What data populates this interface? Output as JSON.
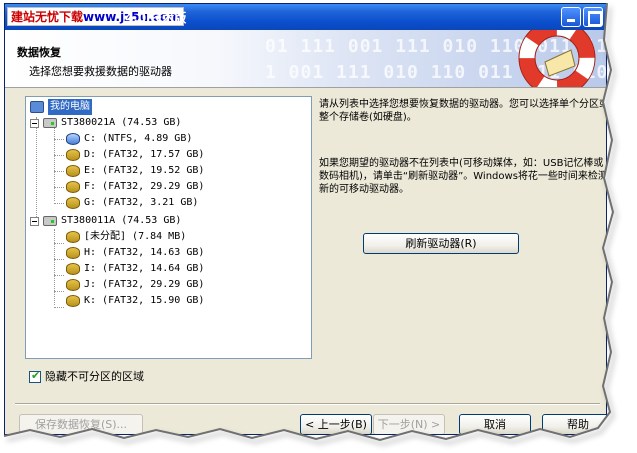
{
  "watermark": {
    "site": "建站无忧下载",
    "url": "www.jz5u.com"
  },
  "titlebar": {
    "title_suffix": "4.0  技术版",
    "minimize": "minimize",
    "maximize": "maximize"
  },
  "header": {
    "title": "数据恢复",
    "subtitle": "选择您想要救援数据的驱动器",
    "binary_line1": "01 111 001 111 010 110 011 111 0",
    "binary_line2": "1 001 111 010 110 011 111 010 110"
  },
  "tree": {
    "root": "我的电脑",
    "disks": [
      {
        "label": "ST380021A  (74.53 GB)",
        "volumes": [
          {
            "label": "C:  (NTFS, 4.89 GB)",
            "icon": "volume-c"
          },
          {
            "label": "D:  (FAT32, 17.57 GB)",
            "icon": "volume"
          },
          {
            "label": "E:  (FAT32, 19.52 GB)",
            "icon": "volume"
          },
          {
            "label": "F:  (FAT32, 29.29 GB)",
            "icon": "volume"
          },
          {
            "label": "G:  (FAT32, 3.21 GB)",
            "icon": "volume"
          }
        ]
      },
      {
        "label": "ST380011A  (74.53 GB)",
        "volumes": [
          {
            "label": "[未分配]  (7.84 MB)",
            "icon": "volume"
          },
          {
            "label": "H:  (FAT32, 14.63 GB)",
            "icon": "volume"
          },
          {
            "label": "I:  (FAT32, 14.64 GB)",
            "icon": "volume"
          },
          {
            "label": "J:  (FAT32, 29.29 GB)",
            "icon": "volume"
          },
          {
            "label": "K:  (FAT32, 15.90 GB)",
            "icon": "volume"
          }
        ]
      }
    ]
  },
  "info": {
    "p1": "请从列表中选择您想要恢复数据的驱动器。您可以选择单个分区或整个存储卷(如硬盘)。",
    "p2": "如果您期望的驱动器不在列表中(可移动媒体，如：USB记忆棒或数码相机)，请单击“刷新驱动器”。Windows将花一些时间来检测新的可移动驱动器。"
  },
  "buttons": {
    "refresh": "刷新驱动器(R)",
    "save": "保存数据恢复(S)...",
    "back": "< 上一步(B)",
    "next": "下一步(N) >",
    "cancel": "取消",
    "help": "帮助"
  },
  "checkbox": {
    "label": "隐藏不可分区的区域",
    "checked": true
  },
  "colors": {
    "titlebar": "#0b4ecd",
    "window_bg": "#ece9d8",
    "selection": "#316ac5"
  }
}
